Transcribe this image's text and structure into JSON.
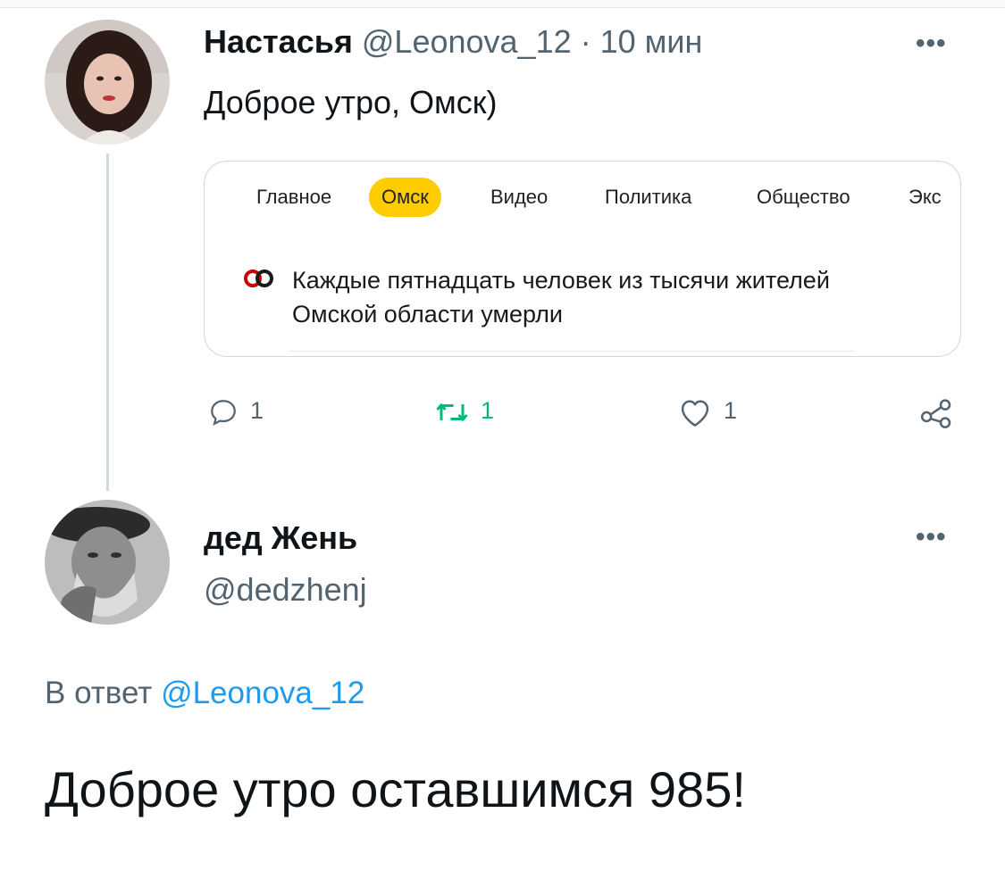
{
  "tweet1": {
    "author_name": "Настасья",
    "author_handle": "@Leonova_12",
    "separator": " · ",
    "time": "10 мин",
    "more_label": "•••",
    "text": "Доброе утро, Омск)",
    "card": {
      "tabs": [
        "Главное",
        "Омск",
        "Видео",
        "Политика",
        "Общество",
        "Экс"
      ],
      "active_tab": "Омск",
      "news_icon": "news-source-icon",
      "news_text": "Каждые пятнадцать человек из тысячи жителей Омской области умерли"
    },
    "actions": {
      "reply_count": "1",
      "retweet_count": "1",
      "like_count": "1"
    }
  },
  "tweet2": {
    "author_name": "дед Жень",
    "author_handle": "@dedzhenj",
    "more_label": "•••",
    "reply_prefix": "В ответ ",
    "reply_mention": "@Leonova_12",
    "text": "Доброе утро оставшимся 985!"
  },
  "colors": {
    "accent": "#1d9bf0",
    "retweet": "#00ba7c",
    "secondary_text": "#536471",
    "active_tab": "#ffcc00",
    "news_icon": "#cc0000"
  }
}
